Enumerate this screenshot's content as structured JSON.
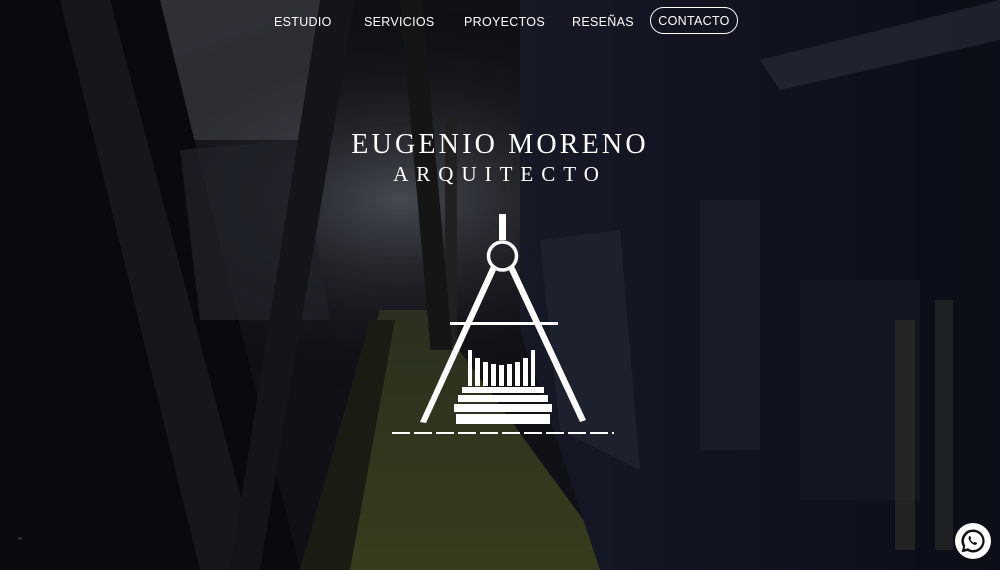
{
  "nav": {
    "items": [
      {
        "label": "ESTUDIO"
      },
      {
        "label": "SERVICIOS"
      },
      {
        "label": "PROYECTOS"
      },
      {
        "label": "RESEÑAS"
      }
    ],
    "contact_label": "CONTACTO"
  },
  "brand": {
    "name": "EUGENIO MORENO",
    "subtitle": "ARQUITECTO",
    "logo_icon": "compass-column-logo"
  },
  "floating": {
    "whatsapp_icon": "whatsapp-icon"
  },
  "colors": {
    "text": "#ffffff",
    "background": "#1a1d26",
    "whatsapp_green": "#25d366"
  }
}
